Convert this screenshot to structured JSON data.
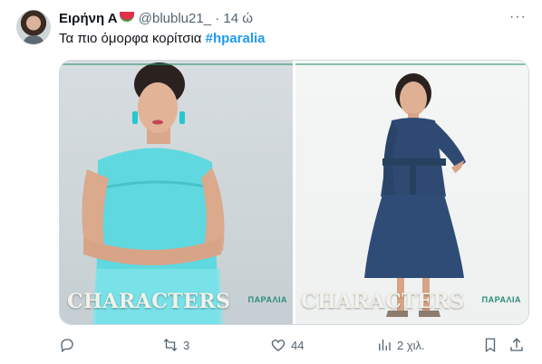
{
  "author": {
    "name": "Ειρήνη Α",
    "handle": "@blublu21_",
    "separator": "·",
    "time": "14 ώ"
  },
  "tweet": {
    "text": "Τα πιο όμορφα κορίτσια ",
    "hashtag": "#hparalia"
  },
  "media": {
    "left_caption": "CHARACTERS",
    "left_logo": "ΠΑΡΑΛΙΑ",
    "right_caption": "CHARACTERS",
    "right_logo": "ΠΑΡΑΛΙΑ"
  },
  "actions": {
    "retweets": "3",
    "likes": "44",
    "views": "2 χιλ."
  },
  "colors": {
    "accent": "#1d9bf0",
    "muted": "#536471",
    "turquoise_dress": "#5fd8e0",
    "navy_dress": "#2e4a73"
  }
}
